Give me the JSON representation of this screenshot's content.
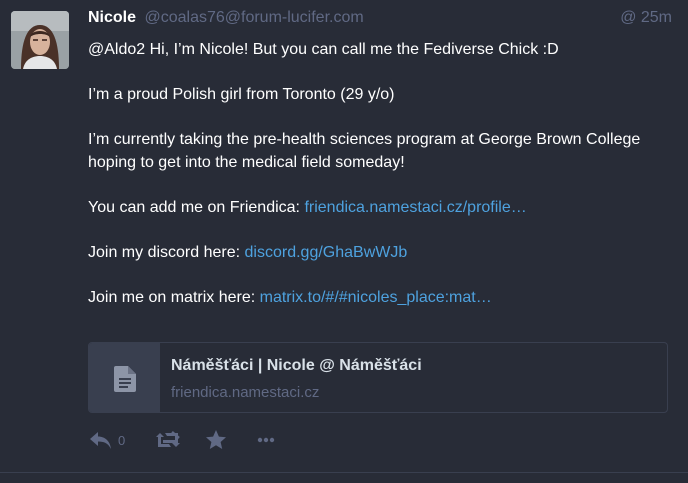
{
  "status": {
    "display_name": "Nicole",
    "acct": "@coalas76@forum-lucifer.com",
    "time": "@ 25m",
    "content": {
      "p1": "@Aldo2 Hi, I’m Nicole! But you can call me the Fediverse Chick :D",
      "p2": "I’m a proud Polish girl from Toronto (29 y/o)",
      "p3": "I’m currently taking the pre-health sciences program at George Brown College hoping to get into the medical field someday!",
      "p4_text": "You can add me on Friendica: ",
      "p4_link": "friendica.namestaci.cz/profile…",
      "p5_text": "Join my discord here: ",
      "p5_link": "discord.gg/GhaBwWJb",
      "p6_text": "Join me on matrix here: ",
      "p6_link": "matrix.to/#/#nicoles_place:mat…"
    },
    "card": {
      "title": "Náměšťáci | Nicole @ Náměšťáci",
      "host": "friendica.namestaci.cz",
      "icon": "file-icon"
    },
    "actions": {
      "reply_count": "0",
      "reply_icon": "reply-icon",
      "boost_icon": "boost-disabled-icon",
      "favourite_icon": "star-icon",
      "more_icon": "ellipsis-icon"
    }
  },
  "colors": {
    "background": "#282c37",
    "link": "#4ea2df",
    "muted": "#606984",
    "text": "#ffffff"
  }
}
